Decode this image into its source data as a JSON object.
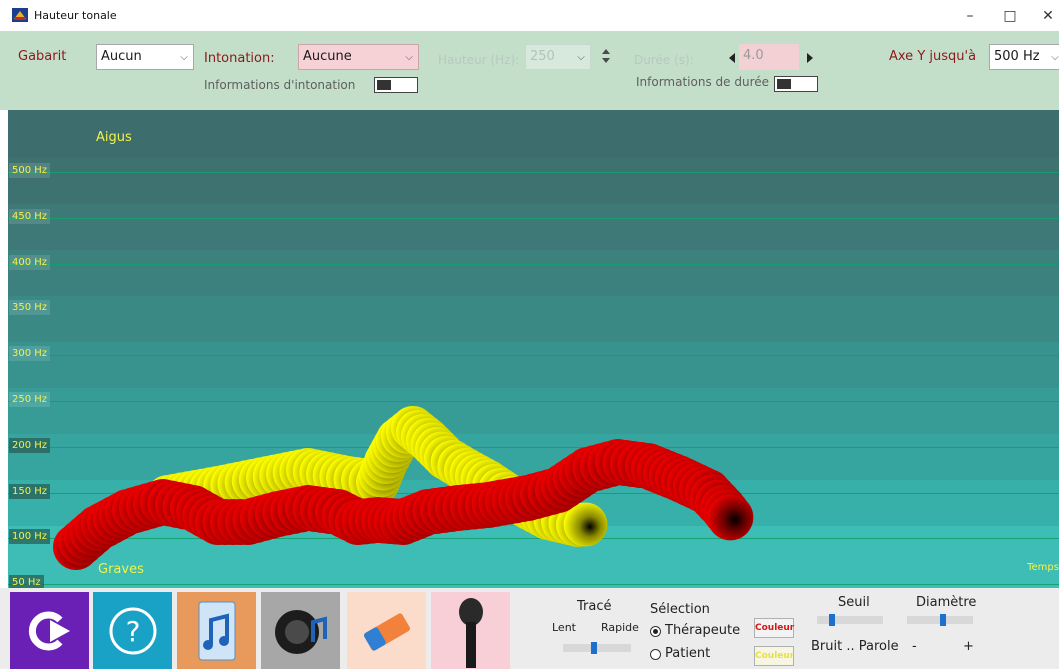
{
  "window": {
    "title": "Hauteur tonale",
    "minimize": "–",
    "maximize": "□",
    "close": "✕"
  },
  "toolbar": {
    "gabarit_label": "Gabarit",
    "gabarit_value": "Aucun",
    "intonation_label": "Intonation:",
    "intonation_value": "Aucune",
    "intonation_info_label": "Informations d'intonation",
    "hauteur_label": "Hauteur (Hz):",
    "hauteur_value": "250",
    "duree_label": "Durée (s):",
    "duree_value": "4.0",
    "duree_info_label": "Informations de durée",
    "axe_label": "Axe Y jusqu'à",
    "axe_value": "500 Hz"
  },
  "plot": {
    "top_label": "Aigus",
    "bottom_label": "Graves",
    "time_label": "Temps",
    "y_ticks": [
      "500 Hz",
      "450 Hz",
      "400 Hz",
      "350 Hz",
      "300 Hz",
      "250 Hz",
      "200 Hz",
      "150 Hz",
      "100 Hz",
      "50 Hz"
    ],
    "colors": {
      "therapist_trace": "#ffff00",
      "patient_trace": "#ee0000",
      "grid": "#11a06e",
      "label": "#f2f24a"
    }
  },
  "bottom": {
    "trace_title": "Tracé",
    "trace_slow": "Lent",
    "trace_fast": "Rapide",
    "trace_speed": 0.45,
    "selection_title": "Sélection",
    "option_therapist": "Thérapeute",
    "option_patient": "Patient",
    "selected": "Thérapeute",
    "color_button": "Couleur",
    "color_button_2": "Couleur",
    "threshold_title": "Seuil",
    "threshold_range": "Bruit .. Parole",
    "threshold_level": 0.2,
    "diameter_title": "Diamètre",
    "diameter_minus": "-",
    "diameter_plus": "+",
    "diameter_level": 0.55,
    "tiles": [
      "restart-icon",
      "help-icon",
      "music-file-icon",
      "speaker-icon",
      "eraser-icon",
      "microphone-icon"
    ]
  }
}
